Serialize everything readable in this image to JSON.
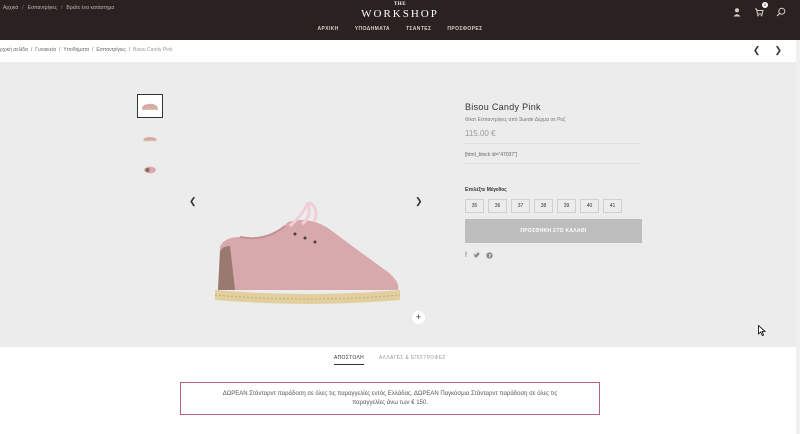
{
  "header": {
    "top_links": [
      "Αρχικά",
      "Εσπαντρίγιες",
      "Βρείτε ένα κατάστημα"
    ],
    "logo_the": "THE",
    "logo_word": "WORKSHOP",
    "nav": [
      "ΑΡΧΙΚΗ",
      "ΥΠΟΔΗΜΑΤΑ",
      "ΤΣΑΝΤΕΣ",
      "ΠΡΟΣΦΟΡΕΣ"
    ],
    "cart_count": "0"
  },
  "breadcrumb": {
    "items": [
      "ρχική σελίδα",
      "Γυναικεία",
      "Υποδήματα",
      "Εσπαντρίγιες"
    ],
    "current": "Bisou Candy Pink"
  },
  "product": {
    "title": "Bisou Candy Pink",
    "subtitle": "Φλατ Εσπαντρίγιες από Suede Δέρμα σε Ροζ",
    "price": "115.00 €",
    "shortcode": "[html_block id=\"47037\"]",
    "size_label": "Επιλέξτε Μέγεθος",
    "sizes": [
      "35",
      "36",
      "37",
      "38",
      "39",
      "40",
      "41"
    ],
    "add_to_cart": "ΠΡΟΣΘΗΚΗ ΣΤΟ ΚΑΛΑΘΙ",
    "shoe_color": "#d8a9ac"
  },
  "tabs": [
    "ΑΠΟΣΤΟΛΗ",
    "ΑΛΛΑΓΕΣ & ΕΠΙΣΤΡΟΦΕΣ"
  ],
  "notice": "ΔΩΡΕΑΝ Στάνταρντ παράδοση σε όλες τις παραγγελίες εντός Ελλάδας. ΔΩΡΕΑΝ Παγκόσμια Στάνταρντ παράδοση σε όλες τις παραγγελίες άνω των € 150."
}
